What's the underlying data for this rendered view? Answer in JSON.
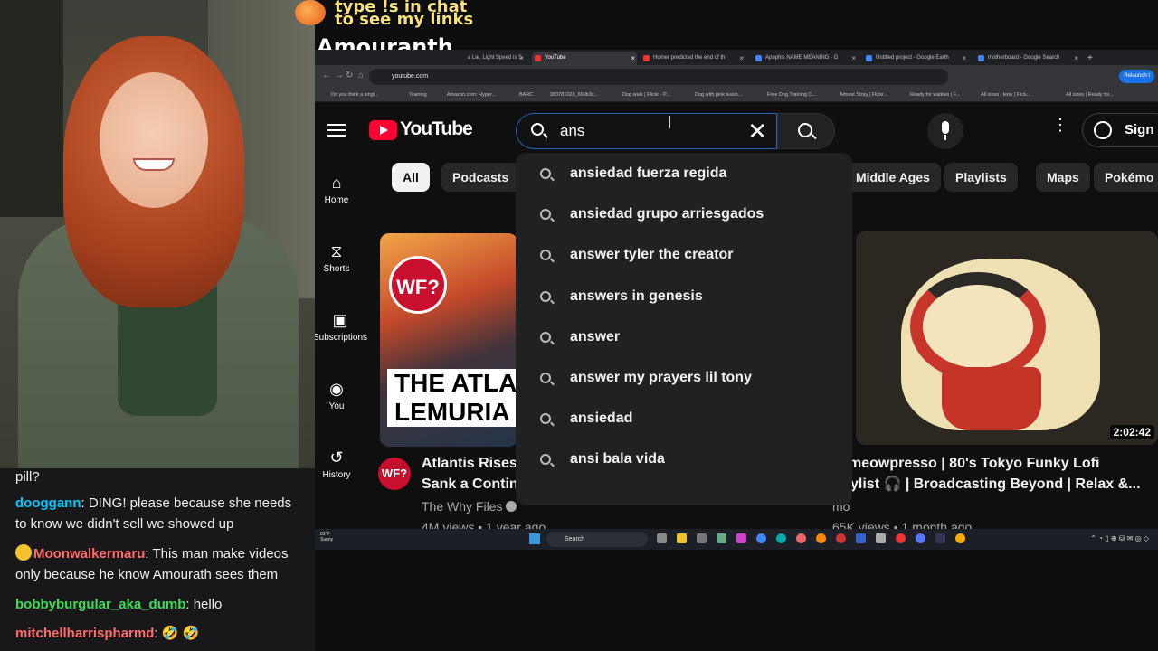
{
  "overlay": {
    "chat_hint_line1": "type !s in chat",
    "chat_hint_line2": "to see my links",
    "streamer_name": "Amouranth"
  },
  "browser": {
    "tabs": [
      {
        "label": "a Lie, Light Speed is S",
        "active": false
      },
      {
        "label": "YouTube",
        "active": true
      },
      {
        "label": "Homer predicted the end of th",
        "active": false
      },
      {
        "label": "Apophis NAME MEANING - G",
        "active": false
      },
      {
        "label": "Untitled project - Google Earth",
        "active": false
      },
      {
        "label": "motherboard - Google Search",
        "active": false
      }
    ],
    "new_tab": "+",
    "url": "youtube.com",
    "relaunch_label": "Relaunch t",
    "bookmarks": [
      "Do you think a singl...",
      "Training",
      "Amazon.com: Hyper...",
      "BARC",
      "383781028_669b3c...",
      "Dog walk | Flickr - P...",
      "Dog with pink leash...",
      "Free Dog Training C...",
      "Almost Stray | Flickr...",
      "Ready for walkies | F...",
      "All sizes | leon | Flick...",
      "All sizes | Ready for..."
    ]
  },
  "youtube": {
    "logo_text": "YouTube",
    "search_value": "ans",
    "clear_glyph": "✕",
    "signin_label": "Sign in",
    "kebab": "⋮",
    "sidebar": [
      {
        "label": "Home",
        "icon": "home-icon",
        "glyph": "⌂"
      },
      {
        "label": "Shorts",
        "icon": "shorts-icon",
        "glyph": "⧖"
      },
      {
        "label": "Subscriptions",
        "icon": "subscriptions-icon",
        "glyph": "▣"
      },
      {
        "label": "You",
        "icon": "you-icon",
        "glyph": "◉"
      },
      {
        "label": "History",
        "icon": "history-icon",
        "glyph": "↺"
      }
    ],
    "chips": [
      "All",
      "Podcasts",
      "Middle Ages",
      "Playlists",
      "Maps",
      "Pokémo"
    ],
    "suggestions": [
      "ansiedad fuerza regida",
      "ansiedad grupo arriesgados",
      "answer tyler the creator",
      "answers in genesis",
      "answer",
      "answer my prayers lil tony",
      "ansiedad",
      "ansi bala vida"
    ],
    "videos": [
      {
        "thumb_badge": "WF?",
        "thumb_line1": "THE ATLA",
        "thumb_line2": "LEMURIA",
        "channel_avatar": "WF?",
        "title_line1": "Atlantis Rises,",
        "title_line2": "Sank a Contine",
        "channel": "The Why Files",
        "meta": "4M views • 1 year ago"
      },
      {
        "duration": "2:02:42",
        "title_line1": "meowpresso | 80's Tokyo Funky Lofi",
        "title_line2": "ylist 🎧 | Broadcasting Beyond | Relax &...",
        "channel": "mo",
        "meta": "65K views • 1 month ago"
      }
    ]
  },
  "taskbar": {
    "weather_temp": "89°F",
    "weather_desc": "Sunny",
    "search_label": "Search"
  },
  "chat": {
    "messages": [
      {
        "name": "",
        "text": "pill?",
        "color": "#efeff1"
      },
      {
        "name": "dooggann",
        "text": ": DING! please because she needs to know we didn't sell we showed up",
        "color": "#00c9ff"
      },
      {
        "name": "Moonwalkermaru",
        "text": ": This man make videos only because he know Amourath sees them",
        "color": "#ff6b6b"
      },
      {
        "name": "bobbyburgular_aka_dumb",
        "text": ": hello",
        "color": "#3ddc57"
      },
      {
        "name": "mitchellharrispharmd",
        "text": ": 🤣 🤣",
        "color": "#ff6b6b"
      }
    ]
  },
  "colors": {
    "youtube_red": "#ff0033",
    "search_focus": "#1c62b9",
    "overlay_yellow": "#f6e07a"
  }
}
